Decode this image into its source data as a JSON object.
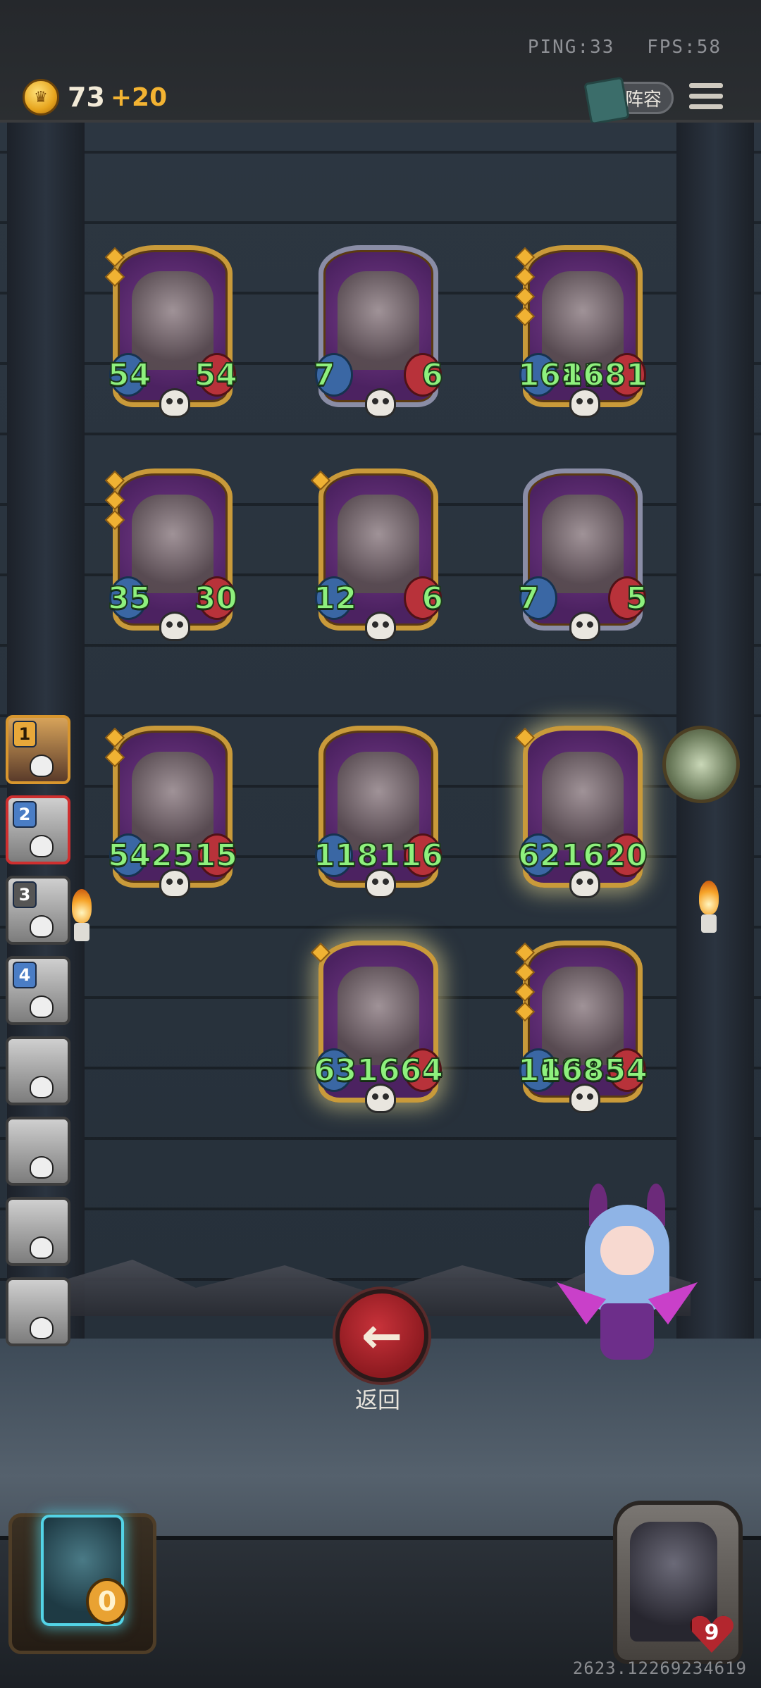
{
  "status": {
    "ping": "PING:33",
    "fps": "FPS:58"
  },
  "currency": {
    "gold": "73",
    "gold_bonus": "+20"
  },
  "toolbar": {
    "team_label": "阵容"
  },
  "board": {
    "cards": [
      {
        "name": "robot-duo-card",
        "atk": "54",
        "hp": "54",
        "frame": "gold",
        "stars": 2
      },
      {
        "name": "masked-rabbit-card",
        "atk": "7",
        "hp": "6",
        "frame": "silver",
        "stars": 0
      },
      {
        "name": "castle-card",
        "atk": "1681",
        "hp": "1681",
        "frame": "gold",
        "stars": 4
      },
      {
        "name": "monster-stack-card",
        "atk": "35",
        "hp": "30",
        "frame": "gold",
        "stars": 3
      },
      {
        "name": "witch-card",
        "atk": "12",
        "hp": "6",
        "frame": "gold",
        "stars": 1
      },
      {
        "name": "pelican-card",
        "atk": "7",
        "hp": "5",
        "frame": "silver",
        "stars": 0
      },
      {
        "name": "pelican-gold-card",
        "atk": "542",
        "hp": "515",
        "frame": "gold",
        "stars": 2
      },
      {
        "name": "frog-apple-card",
        "atk": "118",
        "hp": "116",
        "frame": "gold",
        "stars": 0
      },
      {
        "name": "parrot-card",
        "atk": "621",
        "hp": "620",
        "frame": "gold",
        "stars": 1
      },
      {
        "name": "masked-rabbit-gold-card",
        "atk": "631",
        "hp": "664",
        "frame": "gold",
        "stars": 1
      },
      {
        "name": "octopus-pirate-card",
        "atk": "16843",
        "hp": "16854",
        "frame": "gold",
        "stars": 4
      }
    ]
  },
  "opponents": [
    {
      "rank": "1"
    },
    {
      "rank": "2"
    },
    {
      "rank": "3"
    },
    {
      "rank": "4"
    },
    {
      "rank": ""
    },
    {
      "rank": ""
    },
    {
      "rank": ""
    },
    {
      "rank": ""
    }
  ],
  "actions": {
    "back_label": "返回",
    "back_icon": "←"
  },
  "bottom": {
    "cup_count": "0",
    "lives": "9",
    "seed": "2623.12269234619"
  }
}
